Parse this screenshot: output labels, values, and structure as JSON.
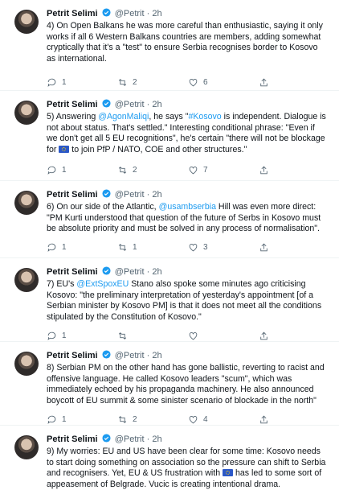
{
  "tweets": [
    {
      "name": "Petrit Selimi",
      "handle": "@Petrit",
      "time": "2h",
      "text_parts": [
        "4) On Open Balkans he was more careful than enthusiastic, saying it only works if all 6 Western Balkans countries are members, adding somewhat cryptically that it's a \"test\" to ensure Serbia recognises border to Kosovo as international."
      ],
      "replies": "1",
      "retweets": "2",
      "likes": "6"
    },
    {
      "name": "Petrit Selimi",
      "handle": "@Petrit",
      "time": "2h",
      "text_a": "5) Answering ",
      "mention": "@AgonMaliqi",
      "text_b": ", he says \"",
      "hashtag": "#Kosovo",
      "text_c": " is independent. Dialogue is not about status. That's settled.\" Interesting conditional phrase: \"Even if we don't get all 5 EU recognitions\", he's certain \"there will not be blockage for ",
      "text_d": " to join PfP / NATO, COE and other structures.\"",
      "replies": "1",
      "retweets": "2",
      "likes": "7"
    },
    {
      "name": "Petrit Selimi",
      "handle": "@Petrit",
      "time": "2h",
      "text_a": "6) On our side of the Atlantic, ",
      "mention": "@usambserbia",
      "text_b": " Hill was even more direct: \"PM Kurti understood that question of the future of Serbs in Kosovo must be absolute priority and must be solved in any process of normalisation\".",
      "replies": "1",
      "retweets": "1",
      "likes": "3"
    },
    {
      "name": "Petrit Selimi",
      "handle": "@Petrit",
      "time": "2h",
      "text_a": "7) EU's ",
      "mention": "@ExtSpoxEU",
      "text_b": " Stano also spoke some minutes ago criticising Kosovo: \"the preliminary interpretation of yesterday's appointment [of a Serbian minister by Kosovo PM] is that it does not meet all the conditions stipulated by the Constitution of Kosovo.\"",
      "replies": "1",
      "retweets": "",
      "likes": ""
    },
    {
      "name": "Petrit Selimi",
      "handle": "@Petrit",
      "time": "2h",
      "text_a": "8) Serbian PM on the other hand has gone ballistic, reverting to racist and offensive language. He called Kosovo leaders \"scum\", which was immediately echoed by his propaganda machinery. He also announced boycott of EU summit & some sinister scenario of blockade in the north\"",
      "replies": "1",
      "retweets": "2",
      "likes": "4"
    },
    {
      "name": "Petrit Selimi",
      "handle": "@Petrit",
      "time": "2h",
      "text_a": "9) My worries: EU and US have been clear for some time: Kosovo needs to start doing something on association so the pressure can shift to Serbia and recognisers. Yet, EU & US frustration with ",
      "text_b": " has led to some sort of appeasement of Belgrade. Vucic is creating intentional drama."
    }
  ],
  "dot": "·",
  "colors": {
    "accent": "#1d9bf0",
    "muted": "#536471"
  },
  "icons": [
    "reply-icon",
    "retweet-icon",
    "like-icon",
    "share-icon",
    "verified-badge-icon",
    "kosovo-flag-icon"
  ]
}
